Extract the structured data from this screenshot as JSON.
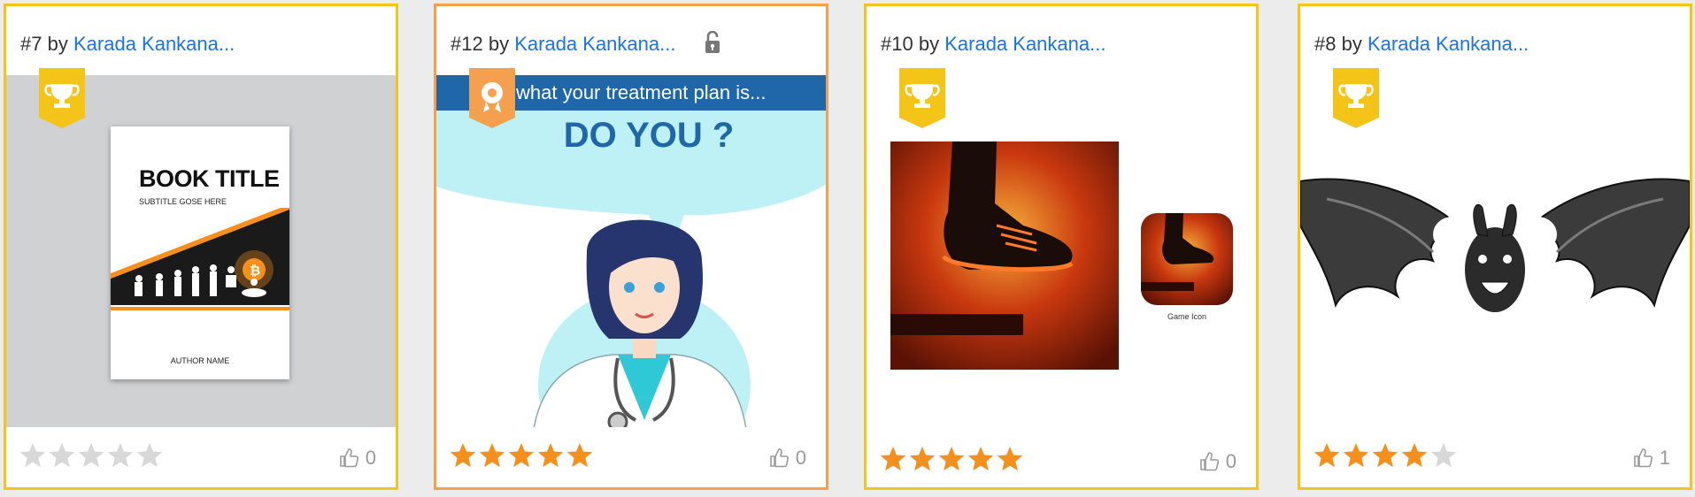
{
  "cards": [
    {
      "rank": "#7",
      "by": "by",
      "author": "Karada Kankana...",
      "rating": 0,
      "likes": "0",
      "badge": "trophy-icon",
      "book": {
        "title": "BOOK TITLE",
        "subtitle": "SUBTITLE GOSE HERE",
        "author": "AUTHOR NAME"
      }
    },
    {
      "rank": "#12",
      "by": "by",
      "author": "Karada Kankana...",
      "rating": 5,
      "likes": "0",
      "badge": "award-ribbon-icon",
      "locked": true,
      "poster": {
        "line1": "what your treatment plan is...",
        "headline": "DO YOU ?"
      }
    },
    {
      "rank": "#10",
      "by": "by",
      "author": "Karada Kankana...",
      "rating": 5,
      "likes": "0",
      "badge": "trophy-icon",
      "game": {
        "caption": "Game Icon"
      }
    },
    {
      "rank": "#8",
      "by": "by",
      "author": "Karada Kankana...",
      "rating": 4,
      "likes": "1",
      "badge": "trophy-icon"
    }
  ],
  "colors": {
    "star_on": "#f5901e",
    "star_off": "#d8d8d8",
    "badge": "#f4c518",
    "link": "#1a73e8",
    "card_border_gold": "#f4c518",
    "card_border_orange": "#f5a04e"
  }
}
